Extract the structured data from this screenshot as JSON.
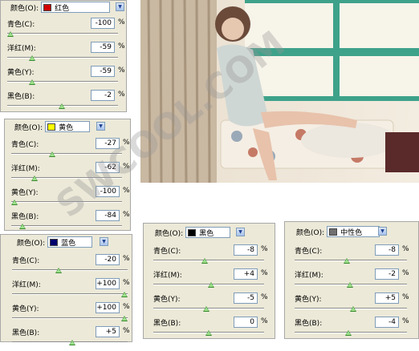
{
  "watermark": "SWCOOL.COM",
  "panels": [
    {
      "id": "red",
      "color_label": "颜色(O):",
      "color_name": "红色",
      "swatch": "#d00000",
      "rows": [
        {
          "label": "青色(C):",
          "value": "-100",
          "pct": "%",
          "level": 0.0
        },
        {
          "label": "洋红(M):",
          "value": "-59",
          "pct": "%",
          "level": 0.205
        },
        {
          "label": "黄色(Y):",
          "value": "-59",
          "pct": "%",
          "level": 0.205
        },
        {
          "label": "黑色(B):",
          "value": "-2",
          "pct": "%",
          "level": 0.49
        }
      ]
    },
    {
      "id": "yellow",
      "color_label": "颜色(O):",
      "color_name": "黄色",
      "swatch": "#ffff00",
      "rows": [
        {
          "label": "青色(C):",
          "value": "-27",
          "pct": "%",
          "level": 0.365
        },
        {
          "label": "洋红(M):",
          "value": "-62",
          "pct": "%",
          "level": 0.19
        },
        {
          "label": "黄色(Y):",
          "value": "-100",
          "pct": "%",
          "level": 0.0
        },
        {
          "label": "黑色(B):",
          "value": "-84",
          "pct": "%",
          "level": 0.08
        }
      ]
    },
    {
      "id": "blue",
      "color_label": "颜色(O):",
      "color_name": "蓝色",
      "swatch": "#00006e",
      "rows": [
        {
          "label": "青色(C):",
          "value": "-20",
          "pct": "%",
          "level": 0.4
        },
        {
          "label": "洋红(M):",
          "value": "+100",
          "pct": "%",
          "level": 1.0
        },
        {
          "label": "黄色(Y):",
          "value": "+100",
          "pct": "%",
          "level": 1.0
        },
        {
          "label": "黑色(B):",
          "value": "+5",
          "pct": "%",
          "level": 0.525
        }
      ]
    },
    {
      "id": "black",
      "color_label": "颜色(O):",
      "color_name": "黑色",
      "swatch": "#000000",
      "rows": [
        {
          "label": "青色(C):",
          "value": "-8",
          "pct": "%",
          "level": 0.46
        },
        {
          "label": "洋红(M):",
          "value": "+4",
          "pct": "%",
          "level": 0.52
        },
        {
          "label": "黄色(Y):",
          "value": "-5",
          "pct": "%",
          "level": 0.475
        },
        {
          "label": "黑色(B):",
          "value": "0",
          "pct": "%",
          "level": 0.5
        }
      ]
    },
    {
      "id": "neutral",
      "color_label": "颜色(O):",
      "color_name": "中性色",
      "swatch": "#707070",
      "rows": [
        {
          "label": "青色(C):",
          "value": "-8",
          "pct": "%",
          "level": 0.46
        },
        {
          "label": "洋红(M):",
          "value": "-2",
          "pct": "%",
          "level": 0.49
        },
        {
          "label": "黄色(Y):",
          "value": "+5",
          "pct": "%",
          "level": 0.525
        },
        {
          "label": "黑色(B):",
          "value": "-4",
          "pct": "%",
          "level": 0.48
        }
      ]
    }
  ]
}
